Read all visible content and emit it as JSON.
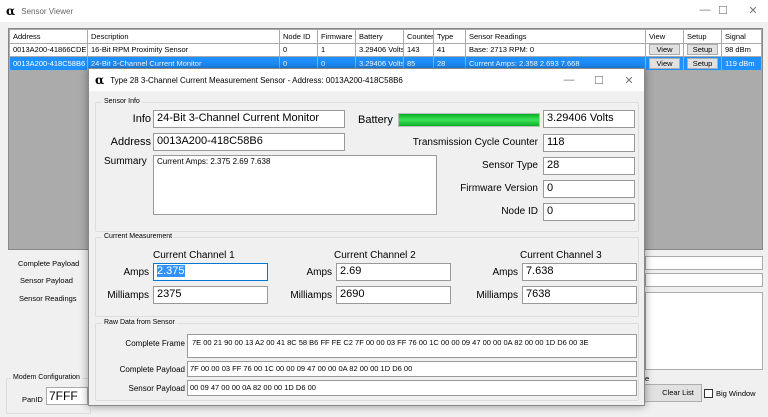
{
  "window": {
    "title": "Sensor Viewer",
    "logo": "α",
    "minimize": "—",
    "maximize": "☐",
    "close": "✕"
  },
  "grid": {
    "headers": [
      "Address",
      "Description",
      "Node ID",
      "Firmware",
      "Battery",
      "Counter",
      "Type",
      "Sensor Readings",
      "View",
      "Setup",
      "Signal"
    ],
    "rows": [
      {
        "address": "0013A200-41866CDE",
        "description": "16-Bit RPM Proximity Sensor",
        "node_id": "0",
        "firmware": "1",
        "battery": "3.29406 Volts",
        "counter": "143",
        "type": "41",
        "readings": "Base: 2713  RPM: 0",
        "view": "View",
        "setup": "Setup",
        "signal": "98 dBm",
        "selected": false
      },
      {
        "address": "0013A200-418C58B6",
        "description": "24-Bit 3-Channel Current Monitor",
        "node_id": "0",
        "firmware": "0",
        "battery": "3.29406 Volts",
        "counter": "85",
        "type": "28",
        "readings": "Current Amps: 2.358 2.693 7.668",
        "view": "View",
        "setup": "Setup",
        "signal": "119 dBm",
        "selected": true
      }
    ]
  },
  "main": {
    "complete_payload_label": "Complete Payload",
    "sensor_payload_label": "Sensor Payload",
    "sensor_readings_label": "Sensor Readings",
    "modem_group": "Modem Configuration",
    "panid_label": "PanID",
    "panid_value": "7FFF",
    "clear_list": "Clear List",
    "big_window": "Big Window",
    "right_group_fragment": "e"
  },
  "dialog": {
    "title": "Type 28 3-Channel Current Measurement Sensor - Address: 0013A200-418C58B6",
    "logo": "α",
    "sensor_info": {
      "group": "Sensor Info",
      "info_label": "Info",
      "info": "24-Bit 3-Channel Current Monitor",
      "address_label": "Address",
      "address": "0013A200-418C58B6",
      "summary_label": "Summary",
      "summary": "Current Amps: 2.375 2.69 7.638",
      "battery_label": "Battery",
      "battery": "3.29406 Volts",
      "battery_level": 1.0,
      "tcc_label": "Transmission Cycle Counter",
      "tcc": "118",
      "type_label": "Sensor Type",
      "type": "28",
      "fw_label": "Firmware Version",
      "fw": "0",
      "node_label": "Node ID",
      "node": "0"
    },
    "current": {
      "group": "Current Measurement",
      "amps_label": "Amps",
      "ma_label": "Milliamps",
      "channels": [
        {
          "title": "Current Channel 1",
          "amps": "2.375",
          "ma": "2375"
        },
        {
          "title": "Current Channel 2",
          "amps": "2.69",
          "ma": "2690"
        },
        {
          "title": "Current Channel 3",
          "amps": "7.638",
          "ma": "7638"
        }
      ]
    },
    "raw": {
      "group": "Raw Data from Sensor",
      "frame_label": "Complete Frame",
      "frame": "7E 00 21 90 00 13 A2 00 41 8C 58 B6 FF FE C2 7F 00 00 03 FF 76 00 1C 00 00 09 47 00 00 0A 82 00 00 1D D6 00 3E",
      "payload_label": "Complete Payload",
      "payload": "7F 00 00 03 FF 76 00 1C 00 00 09 47 00 00 0A 82 00 00 1D D6 00",
      "sensor_payload_label": "Sensor Payload",
      "sensor_payload": "00 09 47 00 00 0A 82 00 00 1D D6 00"
    }
  }
}
